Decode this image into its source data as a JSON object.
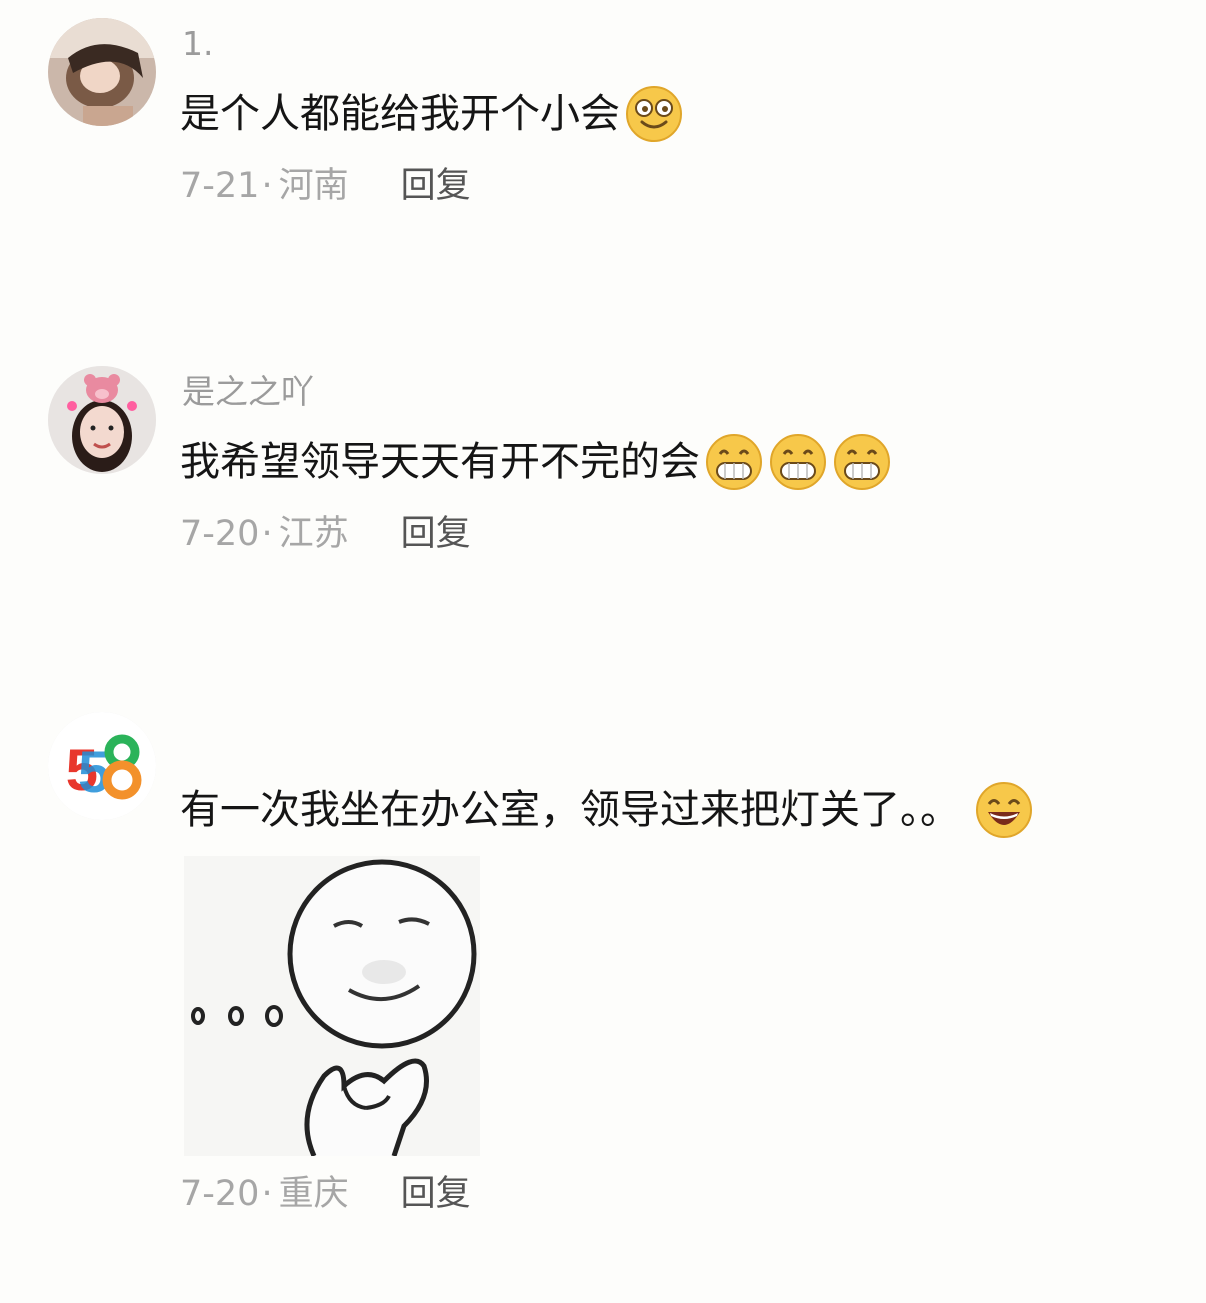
{
  "comments": [
    {
      "username": "1.",
      "text": "是个人都能给我开个小会",
      "date": "7-21",
      "separator": "·",
      "region": "河南",
      "reply_label": "回复",
      "avatar_icon": "avatar-photo-girl",
      "emoji_icons": [
        "dizzy-smile-emoji"
      ]
    },
    {
      "username": "是之之吖",
      "text": "我希望领导天天有开不完的会",
      "date": "7-20",
      "separator": "·",
      "region": "江苏",
      "reply_label": "回复",
      "avatar_icon": "avatar-photo-strawberry-bear-filter",
      "emoji_icons": [
        "grin-emoji",
        "grin-emoji",
        "grin-emoji"
      ]
    },
    {
      "username": "",
      "text": "有一次我坐在办公室，领导过来把灯关了。。",
      "date": "7-20",
      "separator": "·",
      "region": "重庆",
      "reply_label": "回复",
      "avatar_icon": "avatar-58-logo",
      "avatar_logo_text": "58",
      "emoji_icons": [
        "laughing-smile-emoji"
      ],
      "sticker": "thinking-meme-sticker"
    }
  ],
  "colors": {
    "background": "#fdfdfb",
    "text": "#151515",
    "meta": "#a6a6a6",
    "reply": "#555555",
    "emoji_yellow": "#f7c84a"
  }
}
